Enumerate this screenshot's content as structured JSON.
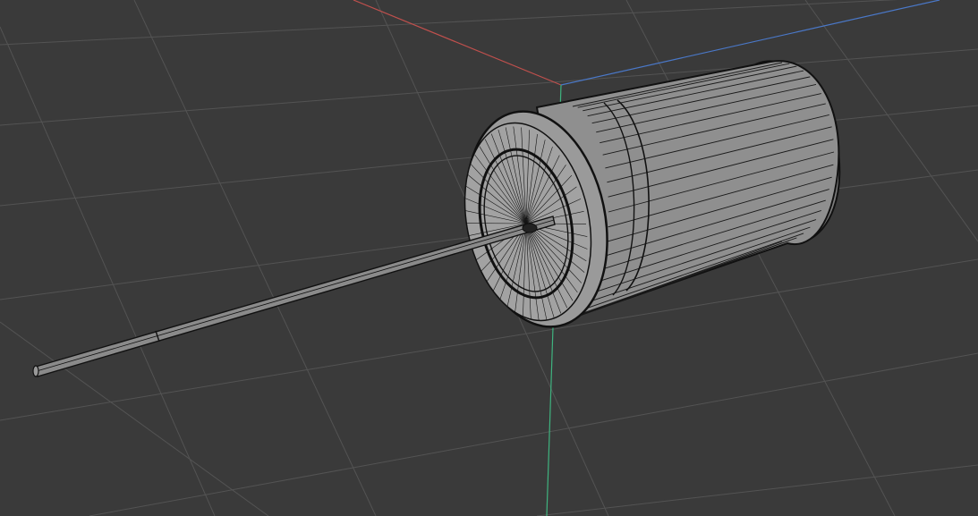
{
  "viewport": {
    "background": "#3a3a3a",
    "grid_color": "#555555",
    "axis_colors": {
      "x": "#c0504d",
      "y": "#3fb37f",
      "z": "#4a78c8"
    },
    "model": {
      "object": "capacitor-mesh",
      "body_fill": "#8f8f8f",
      "cap_fill": "#a2a2a2",
      "wire_fill": "#8a8a8a",
      "edge_color": "#111111",
      "display_mode": "wireframe-on-shaded"
    }
  }
}
